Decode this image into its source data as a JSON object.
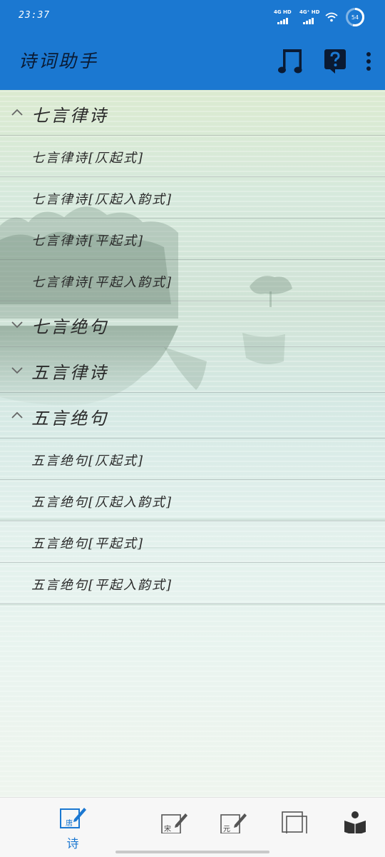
{
  "status_bar": {
    "time": "23:37",
    "signal1_label": "4G HD",
    "signal2_label": "4G⁺ HD",
    "battery_level": "54"
  },
  "app_bar": {
    "title": "诗词助手",
    "actions": [
      {
        "icon": "music-note-icon"
      },
      {
        "icon": "help-icon"
      },
      {
        "icon": "more-vert-icon"
      }
    ]
  },
  "groups": [
    {
      "label": "七言律诗",
      "expanded": true,
      "items": [
        "七言律诗[仄起式]",
        "七言律诗[仄起入韵式]",
        "七言律诗[平起式]",
        "七言律诗[平起入韵式]"
      ]
    },
    {
      "label": "七言绝句",
      "expanded": false,
      "items": []
    },
    {
      "label": "五言律诗",
      "expanded": false,
      "items": []
    },
    {
      "label": "五言绝句",
      "expanded": true,
      "items": [
        "五言绝句[仄起式]",
        "五言绝句[仄起入韵式]",
        "五言绝句[平起式]",
        "五言绝句[平起入韵式]"
      ]
    }
  ],
  "bottom_nav": {
    "items": [
      {
        "icon": "tang-poem-icon",
        "label": "诗",
        "icon_text": "唐",
        "active": true
      },
      {
        "icon": "song-ci-icon",
        "label": "",
        "icon_text": "宋",
        "active": false
      },
      {
        "icon": "yuan-qu-icon",
        "label": "",
        "icon_text": "元",
        "active": false
      },
      {
        "icon": "copy-icon",
        "label": "",
        "active": false
      },
      {
        "icon": "reader-icon",
        "label": "",
        "active": false
      }
    ]
  },
  "colors": {
    "primary": "#1b78d1",
    "app_title": "#0a1a33",
    "list_text": "#2a2a2a",
    "nav_active": "#1b78d1"
  }
}
